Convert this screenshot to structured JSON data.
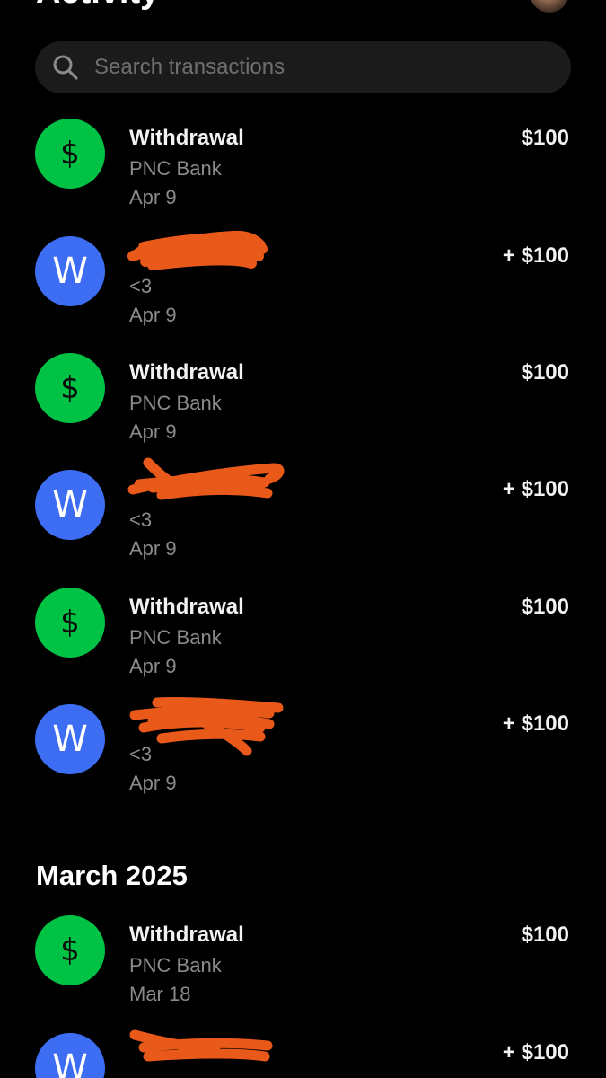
{
  "header": {
    "title": "Activity"
  },
  "search": {
    "placeholder": "Search transactions",
    "value": ""
  },
  "transactions": [
    {
      "avatar": "$",
      "avatar_icon": "dollar-icon",
      "avatar_color": "#00c244",
      "title": "Withdrawal",
      "subtitle": "PNC Bank",
      "date": "Apr 9",
      "amount": "$100"
    },
    {
      "avatar": "W",
      "avatar_color": "#3d6df2",
      "title": "",
      "subtitle": "<3",
      "date": "Apr 9",
      "amount": "+ $100"
    },
    {
      "avatar": "$",
      "avatar_icon": "dollar-icon",
      "avatar_color": "#00c244",
      "title": "Withdrawal",
      "subtitle": "PNC Bank",
      "date": "Apr 9",
      "amount": "$100"
    },
    {
      "avatar": "W",
      "avatar_color": "#3d6df2",
      "title": "",
      "subtitle": "<3",
      "date": "Apr 9",
      "amount": "+ $100"
    },
    {
      "avatar": "$",
      "avatar_icon": "dollar-icon",
      "avatar_color": "#00c244",
      "title": "Withdrawal",
      "subtitle": "PNC Bank",
      "date": "Apr 9",
      "amount": "$100"
    },
    {
      "avatar": "W",
      "avatar_color": "#3d6df2",
      "title": "",
      "subtitle": "<3",
      "date": "Apr 9",
      "amount": "+ $100"
    }
  ],
  "section_march": {
    "title": "March 2025",
    "transactions": [
      {
        "avatar": "$",
        "avatar_icon": "dollar-icon",
        "avatar_color": "#00c244",
        "title": "Withdrawal",
        "subtitle": "PNC Bank",
        "date": "Mar 18",
        "amount": "$100"
      },
      {
        "avatar": "W",
        "avatar_color": "#3d6df2",
        "title": "",
        "subtitle": "",
        "date": "",
        "amount": "+ $100"
      }
    ]
  },
  "colors": {
    "background": "#000000",
    "search_bg": "#1b1b1b",
    "green": "#00c244",
    "blue": "#3d6df2",
    "redaction": "#e8591a",
    "secondary_text": "#8a8a8a"
  }
}
